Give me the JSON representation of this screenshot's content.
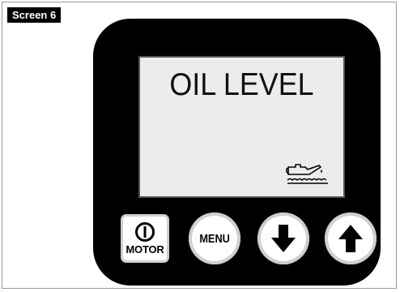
{
  "screen_label": "Screen 6",
  "display": {
    "text": "OIL LEVEL",
    "icon": "oil-can-icon"
  },
  "buttons": {
    "motor": {
      "label": "MOTOR",
      "icon": "power-icon"
    },
    "menu": {
      "label": "MENU"
    },
    "down": {
      "icon": "arrow-down-icon"
    },
    "up": {
      "icon": "arrow-up-icon"
    }
  },
  "colors": {
    "device_body": "#000000",
    "lcd_background": "#ececec",
    "button_face": "#ffffff"
  }
}
